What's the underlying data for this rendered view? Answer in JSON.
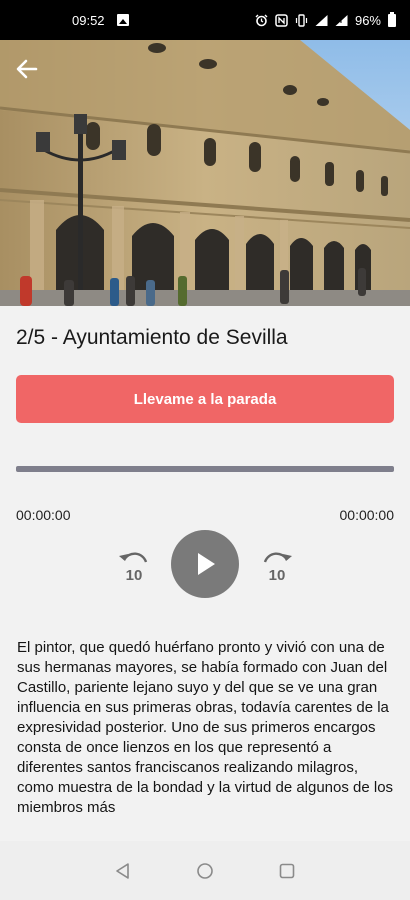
{
  "status_bar": {
    "time": "09:52",
    "battery": "96%",
    "icons": [
      "image-icon",
      "alarm-icon",
      "nfc-icon",
      "vibrate-icon",
      "wifi-icon",
      "signal-icon",
      "battery-icon"
    ]
  },
  "hero": {
    "image": "Ayuntamiento de Sevilla facade photo",
    "back_icon": "arrow-left-icon"
  },
  "stop": {
    "title": "2/5 - Ayuntamiento de Sevilla"
  },
  "cta": {
    "label": "Llevame a la parada",
    "color": "#f06666"
  },
  "player": {
    "current_time": "00:00:00",
    "total_time": "00:00:00",
    "progress": 0,
    "rewind_seconds": "10",
    "forward_seconds": "10",
    "track_color": "#7f7f8c",
    "play_color": "#7a7a7a"
  },
  "description": {
    "text": "El pintor, que quedó huérfano pronto y vivió con una de sus hermanas mayores, se había formado con Juan del Castillo, pariente lejano suyo y del que se ve una gran influencia en sus primeras obras, todavía carentes de la expresividad posterior. Uno de sus primeros encargos consta de once lienzos en los que representó a diferentes santos franciscanos realizando milagros, como muestra de la bondad y la virtud de algunos de los miembros más"
  },
  "nav_bar": {
    "buttons": [
      "back-triangle-icon",
      "home-circle-icon",
      "recents-square-icon"
    ]
  }
}
